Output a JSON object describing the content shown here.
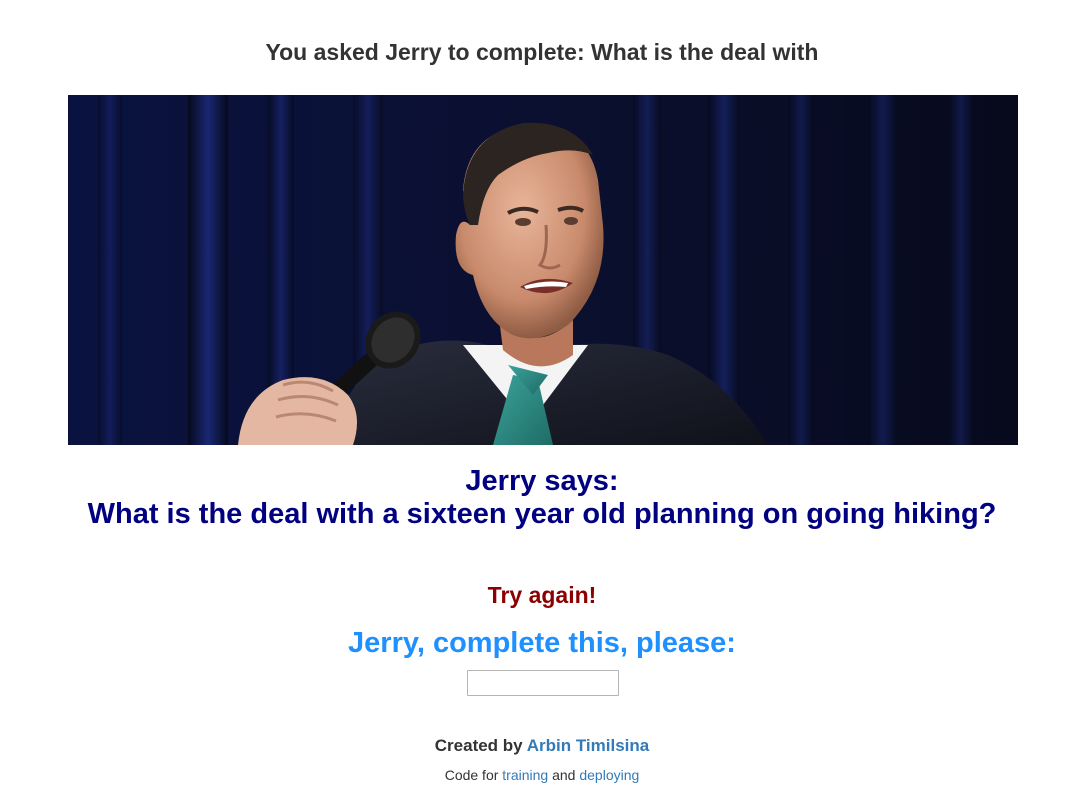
{
  "prompt": {
    "prefix": "You asked Jerry to complete:",
    "text": "What is the deal with"
  },
  "image": {
    "alt": "Jerry"
  },
  "response": {
    "heading": "Jerry says:",
    "text": "What is the deal with a sixteen year old planning on going hiking?"
  },
  "status": {
    "message": "Try again!"
  },
  "form": {
    "heading": "Jerry, complete this, please:",
    "input_value": "",
    "input_placeholder": ""
  },
  "footer": {
    "created_by": "Created by",
    "author_name": "Arbin Timilsina",
    "code_for": "Code for",
    "training_link": "training",
    "and": "and",
    "deploying_link": "deploying"
  },
  "colors": {
    "prompt": "#333333",
    "response": "#000080",
    "try_again": "#8b0000",
    "form_heading": "#1e90ff",
    "link": "#337ab7"
  }
}
